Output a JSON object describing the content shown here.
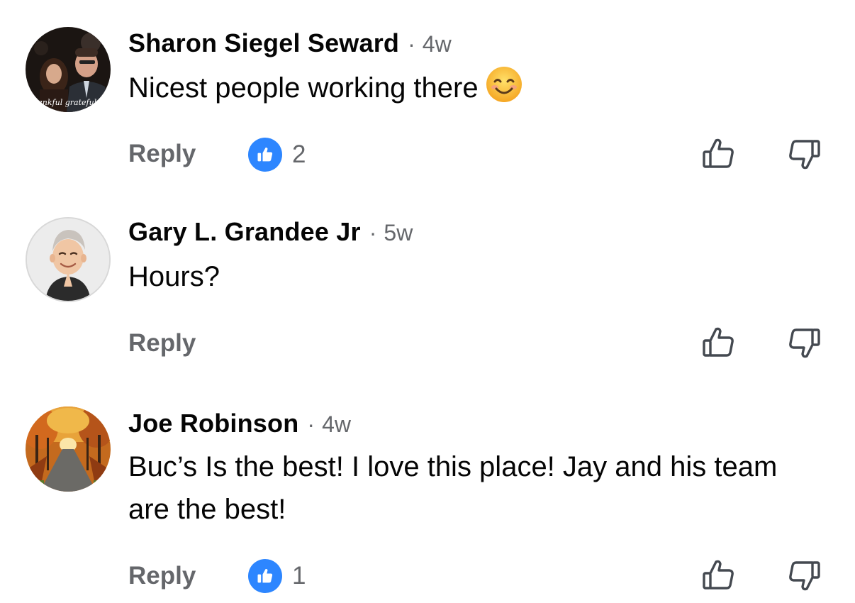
{
  "comments": [
    {
      "author": "Sharon Siegel Seward",
      "separator": "·",
      "time": "4w",
      "text": "Nicest people working there",
      "emoji": "smiling-face-icon",
      "reply_label": "Reply",
      "like_count": "2",
      "avatar_caption": "thankful grateful bl"
    },
    {
      "author": "Gary L. Grandee Jr",
      "separator": "·",
      "time": "5w",
      "text": "Hours?",
      "reply_label": "Reply"
    },
    {
      "author": "Joe Robinson",
      "separator": "·",
      "time": "4w",
      "text": "Buc’s Is the best! I love this place! Jay and his team are the best!",
      "reply_label": "Reply",
      "like_count": "1"
    }
  ],
  "colors": {
    "like_blue": "#2d86ff",
    "secondary_text": "#65676b",
    "primary_text": "#050505"
  }
}
